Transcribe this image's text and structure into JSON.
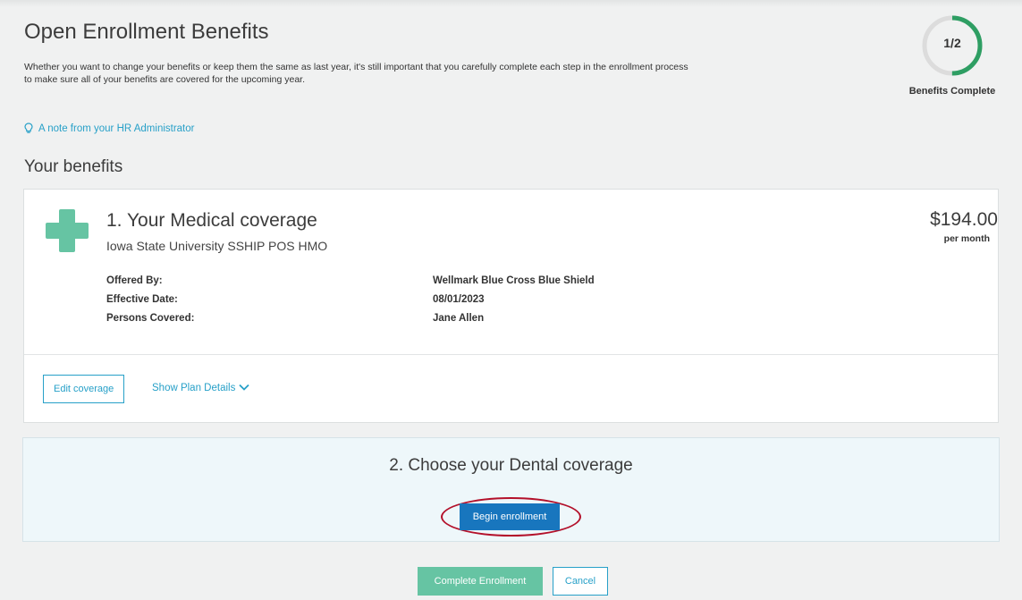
{
  "header": {
    "title": "Open Enrollment Benefits",
    "intro_line1": "Whether you want to change your benefits or keep them the same as last year, it's still important that you carefully complete each step in the enrollment process",
    "intro_line2": "to make sure all of your benefits are covered for the upcoming year."
  },
  "progress": {
    "fraction": "1/2",
    "completed": 1,
    "total": 2,
    "label": "Benefits Complete",
    "track_color": "#dcdcdc",
    "fill_color": "#2e9e63"
  },
  "hr_note": {
    "icon": "lightbulb-icon",
    "label": "A note from your HR Administrator"
  },
  "section": {
    "title": "Your benefits"
  },
  "medical": {
    "icon": "medical-cross-icon",
    "title": "1. Your Medical coverage",
    "plan_name": "Iowa State University SSHIP POS HMO",
    "price": "$194.00",
    "price_unit": "per month",
    "details": [
      {
        "label": "Offered By:",
        "value": "Wellmark Blue Cross Blue Shield"
      },
      {
        "label": "Effective Date:",
        "value": "08/01/2023"
      },
      {
        "label": "Persons Covered:",
        "value": "Jane Allen"
      }
    ],
    "edit_label": "Edit coverage",
    "show_details_label": "Show Plan Details"
  },
  "dental": {
    "title": "2. Choose your Dental coverage",
    "begin_label": "Begin enrollment"
  },
  "footer": {
    "complete_label": "Complete Enrollment",
    "cancel_label": "Cancel"
  },
  "colors": {
    "accent_link": "#27a0c8",
    "primary_button": "#1876be",
    "success_green": "#66c4a3",
    "highlight_red": "#b3102a"
  }
}
